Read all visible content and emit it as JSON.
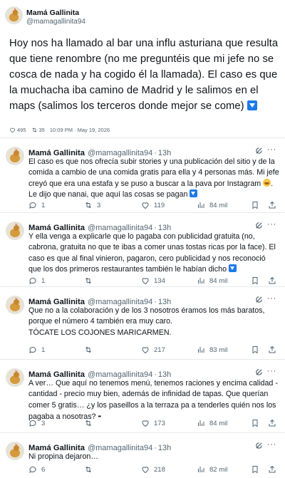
{
  "main_tweet": {
    "author_name": "Mamá Gallinita",
    "author_handle": "@mamagallinita94",
    "text": "Hoy nos ha llamado al bar una influ asturiana que resulta que tiene renombre (no me preguntéis que mi jefe no se cosca de nada y ha cogido él la llamada). El caso es que la muchacha iba camino de Madrid y le salimos en el maps (salimos los terceros donde mejor se come)",
    "likes": "495",
    "retweets": "35",
    "timestamp": "10:09 PM · May 19, 2026"
  },
  "replies": [
    {
      "author_name": "Mamá Gallinita",
      "author_handle": "@mamagallinita94",
      "time": "13h",
      "text_a": "El caso es que nos ofrecía subir stories y una publicación del sitio y de la comida a cambio de una comida gratis para ella y 4 personas más. Mi jefe creyó que era una estafa y se puso a buscar a la pava por Instagram",
      "text_b": ". Le dijo que nanai, que aquí las cosas se pagan",
      "replies": "1",
      "retweets": "3",
      "likes": "119",
      "views": "84 mil"
    },
    {
      "author_name": "Mamá Gallinita",
      "author_handle": "@mamagallinita94",
      "time": "13h",
      "text_a": "Y ella venga a explicarle que lo pagaba con publicidad gratuita (no, cabrona, gratuita no que te ibas a comer unas tostas ricas por la face). El caso es que al final vinieron, pagaron, cero publicidad y nos reconoció que los dos primeros restaurantes también le habían dicho",
      "replies": "1",
      "retweets": "",
      "likes": "134",
      "views": "84 mil"
    },
    {
      "author_name": "Mamá Gallinita",
      "author_handle": "@mamagallinita94",
      "time": "13h",
      "line1": "Que no a la colaboración y de los 3 nosotros éramos los más baratos,",
      "line2": "porque el número 4 también era muy caro.",
      "line3": "TÓCATE LOS COJONES MARICARMEN.",
      "replies": "1",
      "retweets": "",
      "likes": "217",
      "views": "83 mil"
    },
    {
      "author_name": "Mamá Gallinita",
      "author_handle": "@mamagallinita94",
      "time": "13h",
      "text_a": "A ver… Que aquí no tenemos menú, tenemos raciones y encima calidad - cantidad - precio muy bien, además de infinidad de tapas. Que querían comer 5 gratis… ¿y los paseillos a la terraza pa a tenderles quién nos los pagaba a nosotras?",
      "replies": "3",
      "retweets": "",
      "likes": "173",
      "views": "84 mil"
    },
    {
      "author_name": "Mamá Gallinita",
      "author_handle": "@mamagallinita94",
      "time": "13h",
      "text_a": "Ni propina dejaron…",
      "replies": "6",
      "retweets": "",
      "likes": "218",
      "views": "82 mil"
    }
  ]
}
